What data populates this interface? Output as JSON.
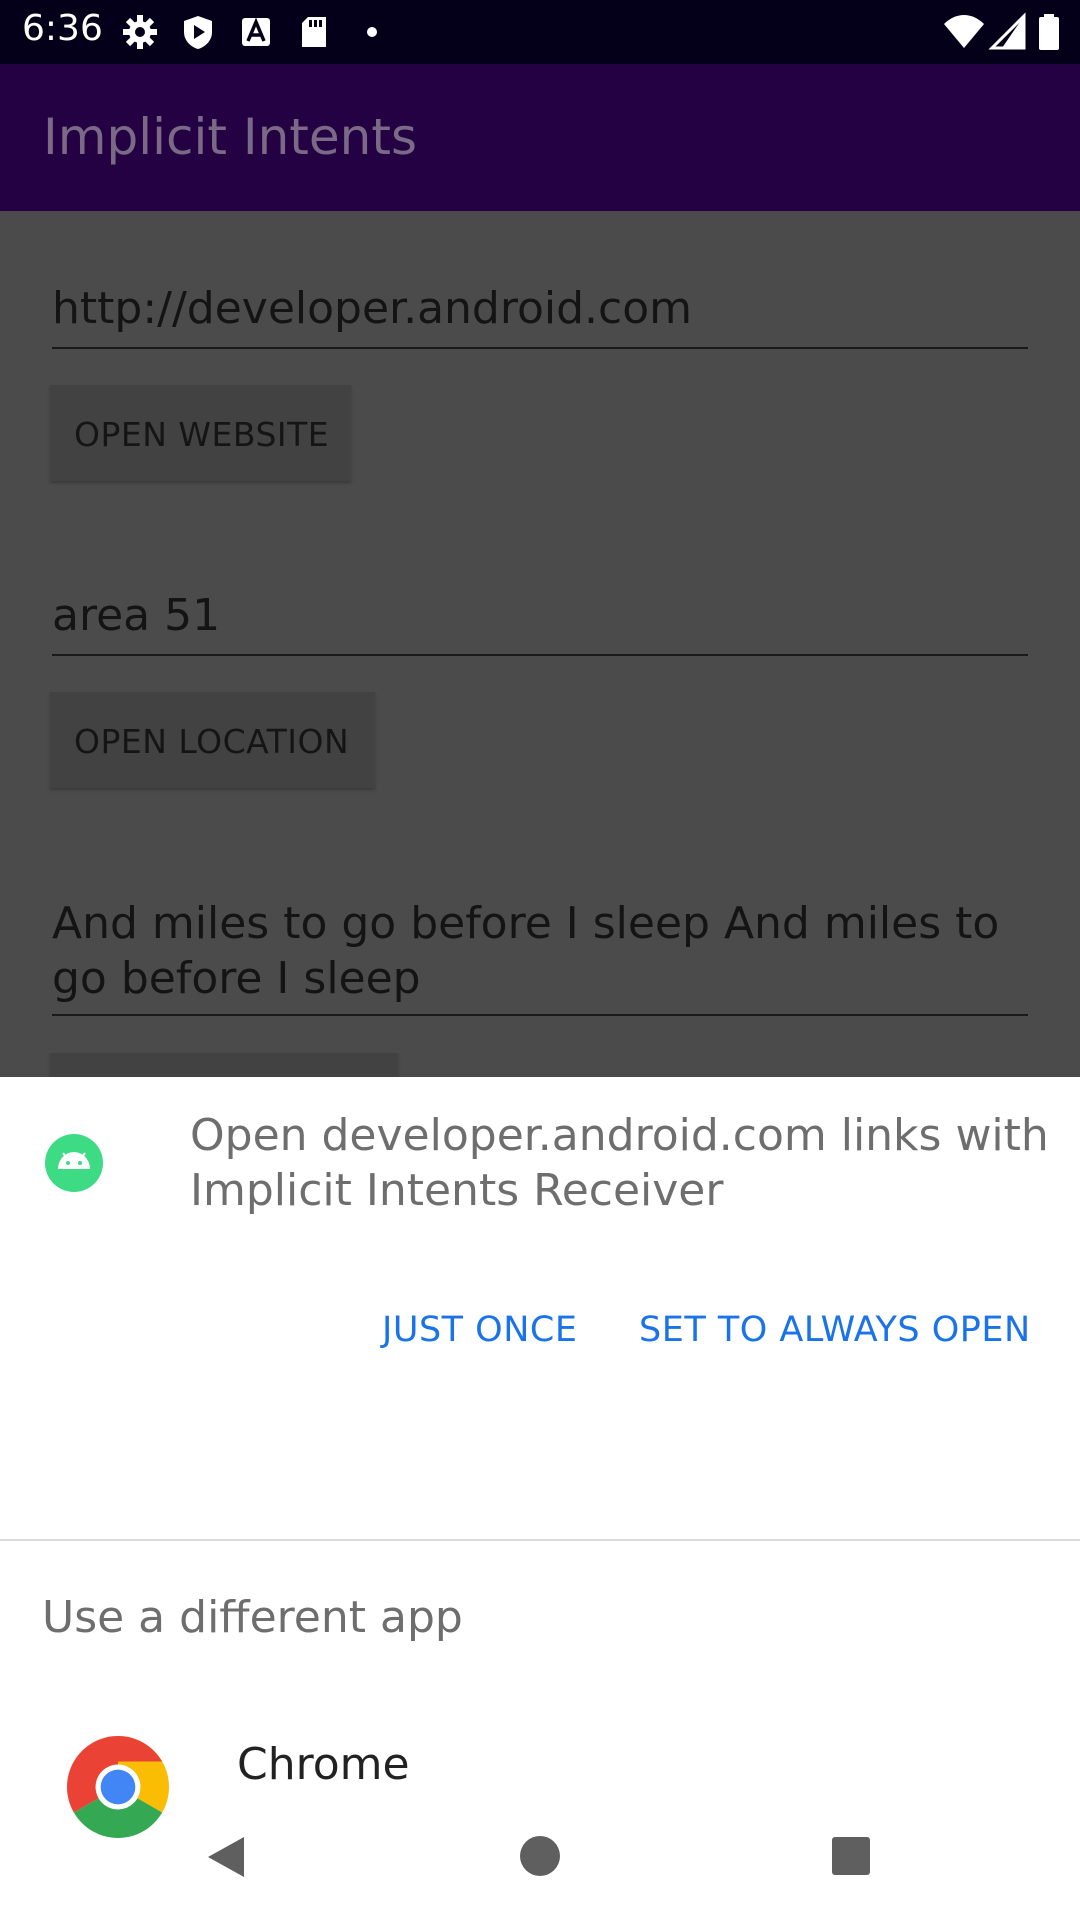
{
  "status_bar": {
    "time": "6:36",
    "left_icons": [
      "settings-icon",
      "play-protect-icon",
      "text-a-icon",
      "sd-card-icon",
      "dot-icon"
    ],
    "right_icons": [
      "wifi-icon",
      "cell-signal-icon",
      "battery-icon"
    ]
  },
  "app_bar": {
    "title": "Implicit Intents"
  },
  "main": {
    "website_field": "http://developer.android.com",
    "open_website_label": "OPEN WEBSITE",
    "location_field": "area 51",
    "open_location_label": "OPEN LOCATION",
    "share_field": "And miles to go before I sleep And miles to go before I sleep"
  },
  "sheet": {
    "title": "Open developer.android.com links with Implicit Intents Receiver",
    "just_once_label": "JUST ONCE",
    "always_open_label": "SET TO ALWAYS OPEN",
    "different_app_label": "Use a different app",
    "apps": [
      {
        "name": "Chrome"
      }
    ]
  },
  "nav_bar": {
    "icons": [
      "back-icon",
      "home-icon",
      "recents-icon"
    ]
  },
  "colors": {
    "status_bar": "#05001a",
    "app_bar": "#230143",
    "scrim_content": "#4b4b4b",
    "accent_button_text": "#1a73e8",
    "android_icon_green": "#3ddc84"
  }
}
